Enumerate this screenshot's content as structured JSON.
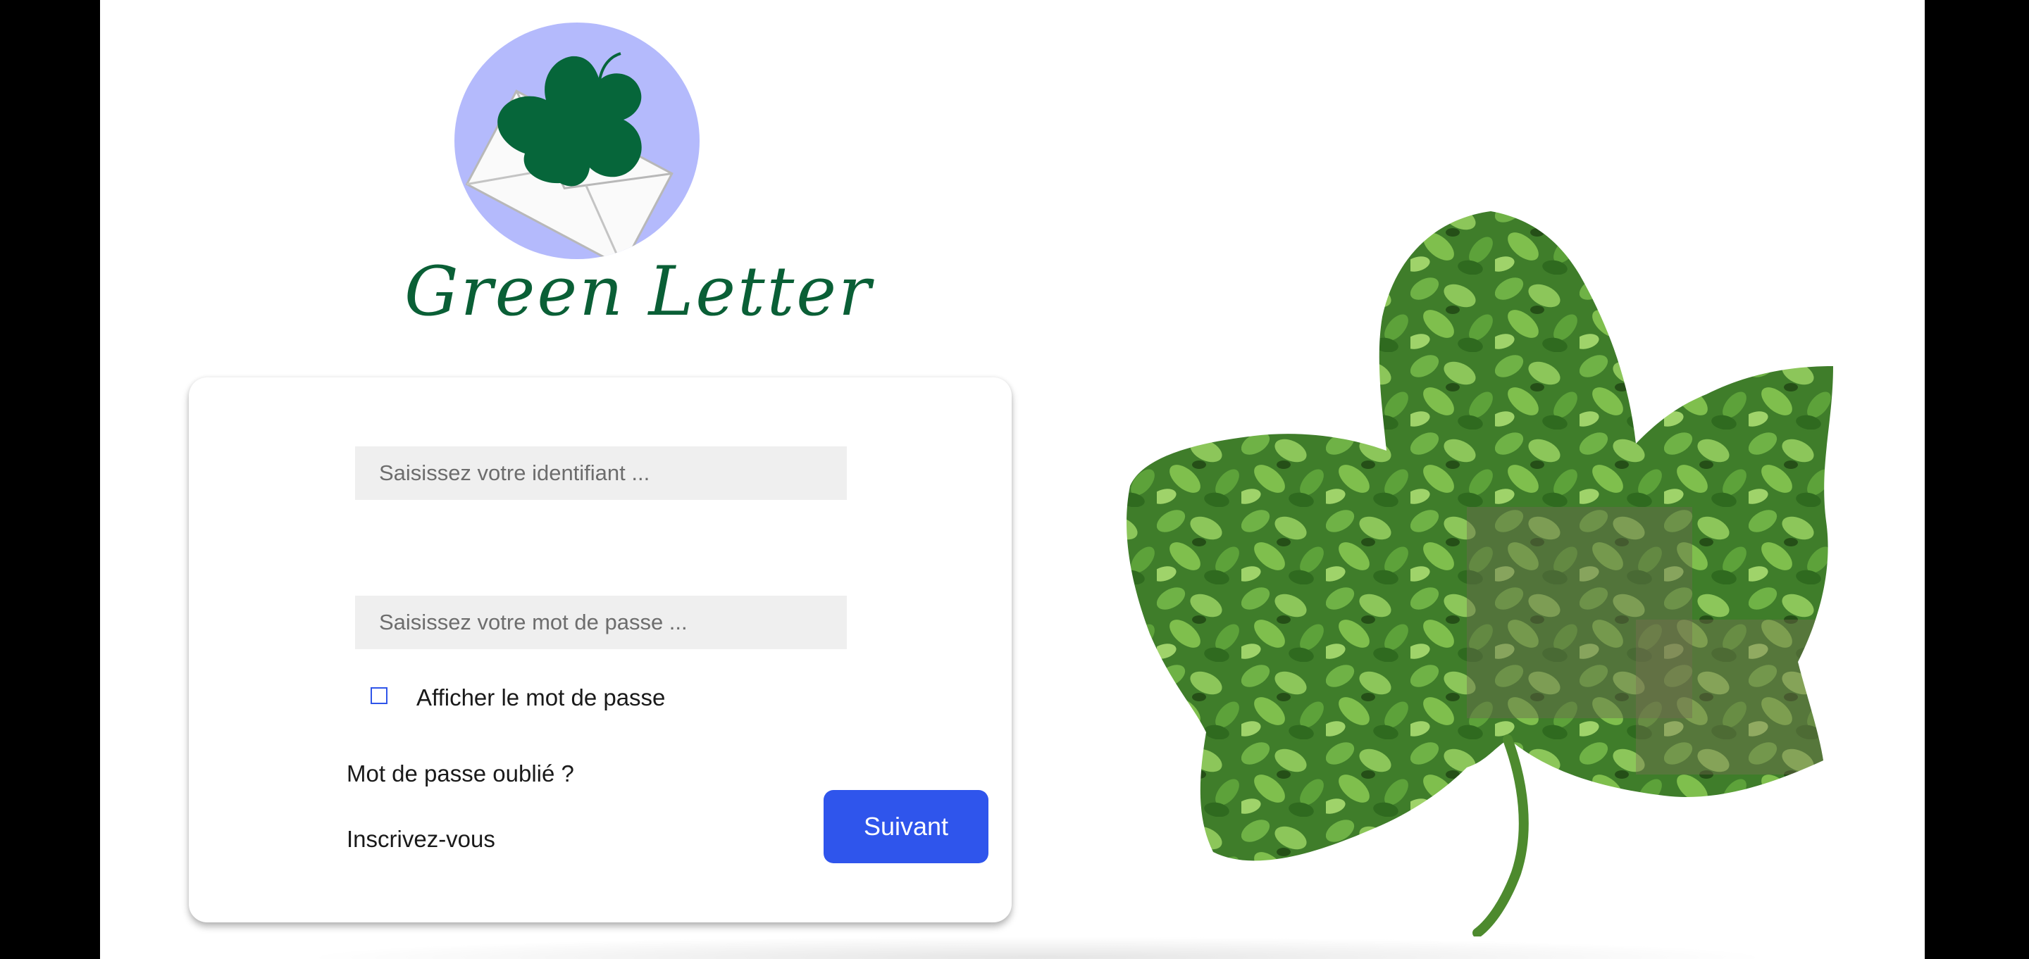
{
  "brand": {
    "name": "Green Letter",
    "logo_icon": "ivy-leaf-envelope-icon",
    "logo_bg_color": "#b4bafc",
    "brand_color": "#0a5f36"
  },
  "login": {
    "username_placeholder": "Saisissez votre identifiant ...",
    "password_placeholder": "Saisissez votre mot de passe ...",
    "show_password_label": "Afficher le mot de passe",
    "show_password_checked": false,
    "forgot_password_link": "Mot de passe oublié ?",
    "signup_link": "Inscrivez-vous",
    "submit_label": "Suivant",
    "accent_color": "#2f55ec"
  },
  "illustration": {
    "icon": "ivy-leaf-foliage-image"
  }
}
